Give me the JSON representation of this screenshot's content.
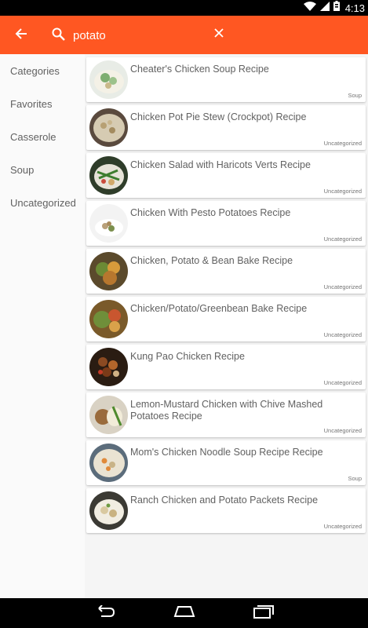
{
  "status_bar": {
    "time": "4:13",
    "icons": [
      "wifi-icon",
      "cell-signal-icon",
      "battery-icon"
    ]
  },
  "app_bar": {
    "color": "#ff5722",
    "back_icon": "arrow-left-icon",
    "search_icon": "search-icon",
    "search_value": "potato",
    "clear_icon": "close-icon"
  },
  "sidebar": {
    "items": [
      {
        "label": "Categories"
      },
      {
        "label": "Favorites"
      },
      {
        "label": "Casserole"
      },
      {
        "label": "Soup"
      },
      {
        "label": "Uncategorized"
      }
    ]
  },
  "recipes": [
    {
      "title": "Cheater's Chicken Soup Recipe",
      "category": "Soup"
    },
    {
      "title": "Chicken Pot Pie Stew (Crockpot) Recipe",
      "category": "Uncategorized"
    },
    {
      "title": "Chicken Salad with Haricots Verts Recipe",
      "category": "Uncategorized"
    },
    {
      "title": "Chicken With Pesto Potatoes Recipe",
      "category": "Uncategorized"
    },
    {
      "title": "Chicken, Potato & Bean Bake Recipe",
      "category": "Uncategorized"
    },
    {
      "title": "Chicken/Potato/Greenbean Bake Recipe",
      "category": "Uncategorized"
    },
    {
      "title": "Kung Pao Chicken Recipe",
      "category": "Uncategorized"
    },
    {
      "title": "Lemon-Mustard Chicken with Chive Mashed Potatoes Recipe",
      "category": "Uncategorized"
    },
    {
      "title": "Mom's Chicken Noodle Soup Recipe Recipe",
      "category": "Soup"
    },
    {
      "title": "Ranch Chicken and Potato Packets Recipe",
      "category": "Uncategorized"
    }
  ],
  "nav_bar": {
    "buttons": [
      "back-nav-icon",
      "home-icon",
      "recents-icon"
    ]
  }
}
